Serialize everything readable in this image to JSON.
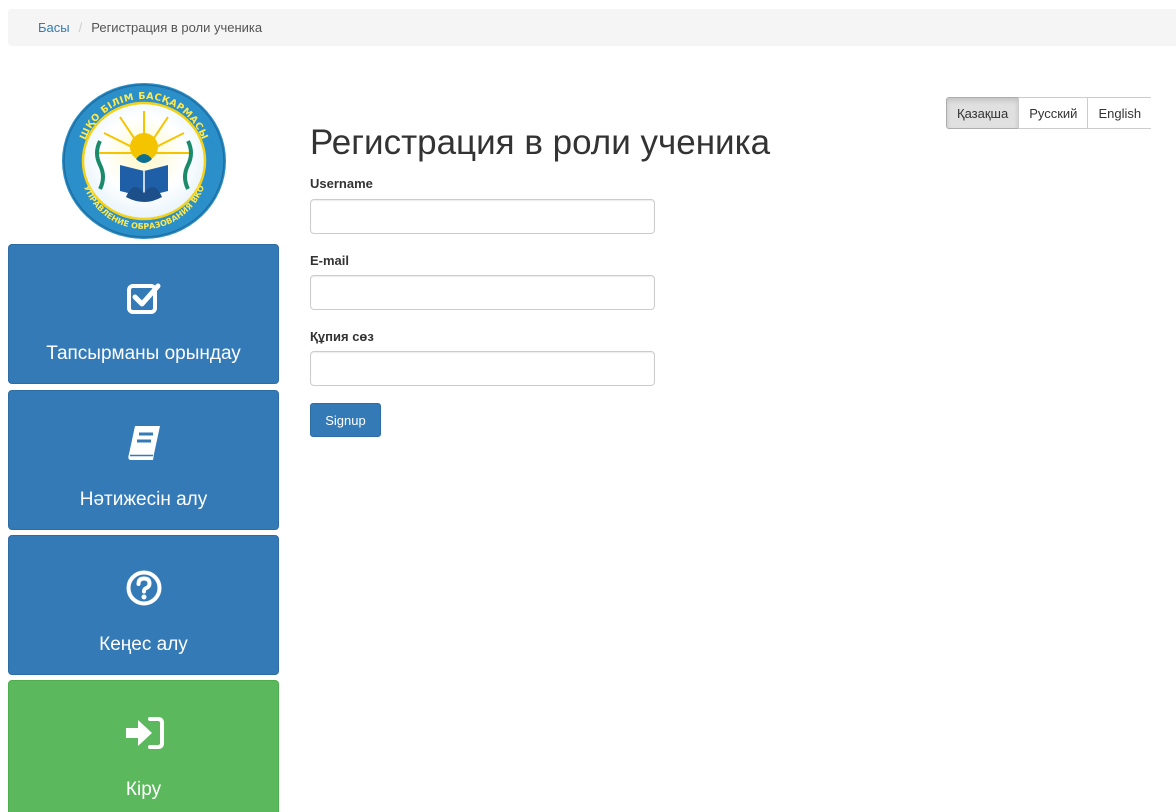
{
  "breadcrumb": {
    "home": "Басы",
    "separator": "/",
    "current": "Регистрация в роли ученика"
  },
  "logo": {
    "top_text": "ШҚО БІЛІМ БАСҚАРМАСЫ",
    "bottom_text": "УПРАВЛЕНИЕ ОБРАЗОВАНИЯ ВКО"
  },
  "sidebar": {
    "tiles": [
      {
        "label": "Тапсырманы орындау",
        "icon": "check-square-icon",
        "color": "#337ab7"
      },
      {
        "label": "Нәтижесін алу",
        "icon": "book-icon",
        "color": "#337ab7"
      },
      {
        "label": "Кеңес алу",
        "icon": "question-circle-icon",
        "color": "#337ab7"
      },
      {
        "label": "Кіру",
        "icon": "sign-in-icon",
        "color": "#5cb85c"
      }
    ]
  },
  "languages": {
    "options": [
      "Қазақша",
      "Русский",
      "English"
    ],
    "selected": "Қазақша"
  },
  "form": {
    "title": "Регистрация в роли ученика",
    "username_label": "Username",
    "username_value": "",
    "email_label": "E-mail",
    "email_value": "",
    "password_label": "Құпия сөз",
    "password_value": "",
    "submit_label": "Signup"
  }
}
